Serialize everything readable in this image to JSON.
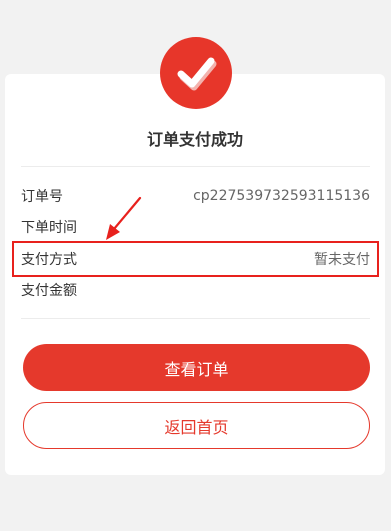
{
  "result": {
    "title": "订单支付成功",
    "icon": "checkmark-icon"
  },
  "details": [
    {
      "label": "订单号",
      "value": "cp227539732593115136"
    },
    {
      "label": "下单时间",
      "value": ""
    },
    {
      "label": "支付方式",
      "value": "暂未支付"
    },
    {
      "label": "支付金额",
      "value": ""
    }
  ],
  "actions": {
    "view_order": "查看订单",
    "back_home": "返回首页"
  },
  "colors": {
    "accent": "#e5392c",
    "highlight_border": "#e8211d",
    "background": "#f2f2f2"
  }
}
